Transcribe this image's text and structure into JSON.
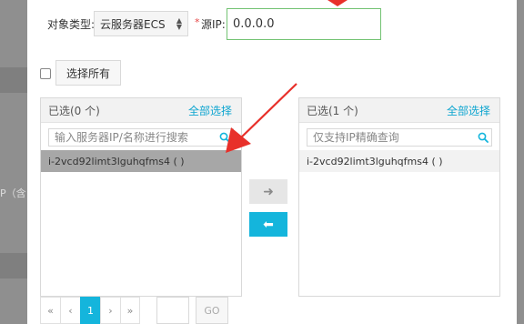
{
  "backdrop": {
    "edge_text": "P（含"
  },
  "filter": {
    "type_label": "对象类型:",
    "type_value": "云服务器ECS",
    "required_mark": "*",
    "ip_label": "源IP:",
    "ip_value": "0.0.0.0"
  },
  "select_all": {
    "label": "选择所有"
  },
  "left_panel": {
    "title": "已选(0 个)",
    "select_all_link": "全部选择",
    "search_placeholder": "输入服务器IP/名称进行搜索",
    "items": [
      {
        "label": "i-2vcd92limt3lguhqfms4 ( )"
      }
    ]
  },
  "right_panel": {
    "title": "已选(1 个)",
    "select_all_link": "全部选择",
    "search_placeholder": "仅支持IP精确查询",
    "items": [
      {
        "label": "i-2vcd92limt3lguhqfms4 ( )"
      }
    ]
  },
  "transfer": {
    "move_right_symbol": "➜",
    "move_left_symbol": "⬅"
  },
  "pagination": {
    "first": "«",
    "prev": "‹",
    "current_page": "1",
    "next": "›",
    "last": "»",
    "go_label": "GO"
  },
  "colors": {
    "accent": "#14b5dc",
    "link": "#0ea5d0",
    "annotation": "#e8302a",
    "input_focus_border": "#73c373"
  },
  "icons": {
    "search": "search-icon",
    "select_arrows": "updown-arrows-icon"
  }
}
